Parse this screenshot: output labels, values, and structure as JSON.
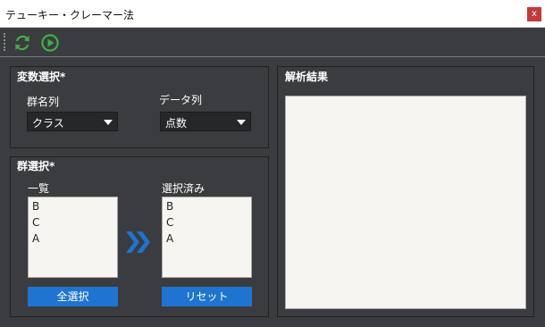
{
  "window": {
    "title": "テューキー・クレーマー法",
    "close_label": "x"
  },
  "toolbar": {
    "icons": [
      "refresh-icon",
      "play-icon"
    ],
    "accent": "#3fae49"
  },
  "variable_panel": {
    "title": "変数選択*",
    "group_label": "群名列",
    "group_value": "クラス",
    "data_label": "データ列",
    "data_value": "点数"
  },
  "group_panel": {
    "title": "群選択*",
    "list_label": "一覧",
    "list_items": [
      "B",
      "C",
      "A"
    ],
    "selected_label": "選択済み",
    "selected_items": [
      "B",
      "C",
      "A"
    ],
    "select_all_label": "全選択",
    "reset_label": "リセット",
    "move_icon": "double-chevron-right-icon"
  },
  "result_panel": {
    "title": "解析結果"
  },
  "colors": {
    "background": "#3a3c3f",
    "button": "#1e74d0",
    "close": "#c43a3a"
  }
}
